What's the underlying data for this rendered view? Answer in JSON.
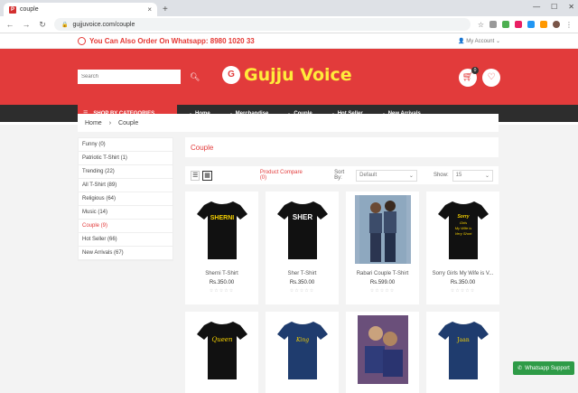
{
  "browser": {
    "tab_title": "couple",
    "url": "gujjuvoice.com/couple"
  },
  "topstrip": {
    "whatsapp_text": "You Can Also Order On Whatsapp:  8980 1020 33",
    "account_label": "My Account"
  },
  "header": {
    "search_placeholder": "Search",
    "logo_text": "Gujju Voice",
    "cart_count": "0"
  },
  "nav": {
    "categories_label": "SHOP BY CATEGORIES",
    "items": [
      "Home",
      "Merchandise",
      "Couple",
      "Hot Seller",
      "New Arrivals"
    ]
  },
  "breadcrumb": [
    "Home",
    "Couple"
  ],
  "sidebar": {
    "items": [
      "Funny (0)",
      "Patriotic T-Shirt (1)",
      "Trending (22)",
      "All T-Shirt (89)",
      "Religious (64)",
      "Music (14)",
      "Couple (9)",
      "Hot Seller (66)",
      "New Arrivals (67)"
    ]
  },
  "main": {
    "title": "Couple",
    "compare_label": "Product Compare (0)",
    "sort_label": "Sort By:",
    "sort_value": "Default",
    "show_label": "Show:",
    "show_value": "15"
  },
  "products": [
    {
      "name": "Sherni T-Shirt",
      "price": "Rs.350.00",
      "print": "SHERNI"
    },
    {
      "name": "Sher T-Shirt",
      "price": "Rs.350.00",
      "print": "SHER"
    },
    {
      "name": "Rabari Couple T-Shirt",
      "price": "Rs.599.00",
      "print": ""
    },
    {
      "name": "Sorry Girls My Wife is V...",
      "price": "Rs.350.00",
      "print": "Sorry Girls My Wife is Very Short"
    }
  ],
  "products_row2": [
    {
      "print": "Queen"
    },
    {
      "print": "King"
    },
    {
      "print": ""
    },
    {
      "print": "Jaan"
    }
  ],
  "whatsapp_support": "Whatsapp Support",
  "colors": {
    "brand_red": "#e23b3b",
    "nav_dark": "#2d2d2d",
    "logo_yellow": "#ffeb3b",
    "whatsapp_green": "#2e9b47"
  }
}
